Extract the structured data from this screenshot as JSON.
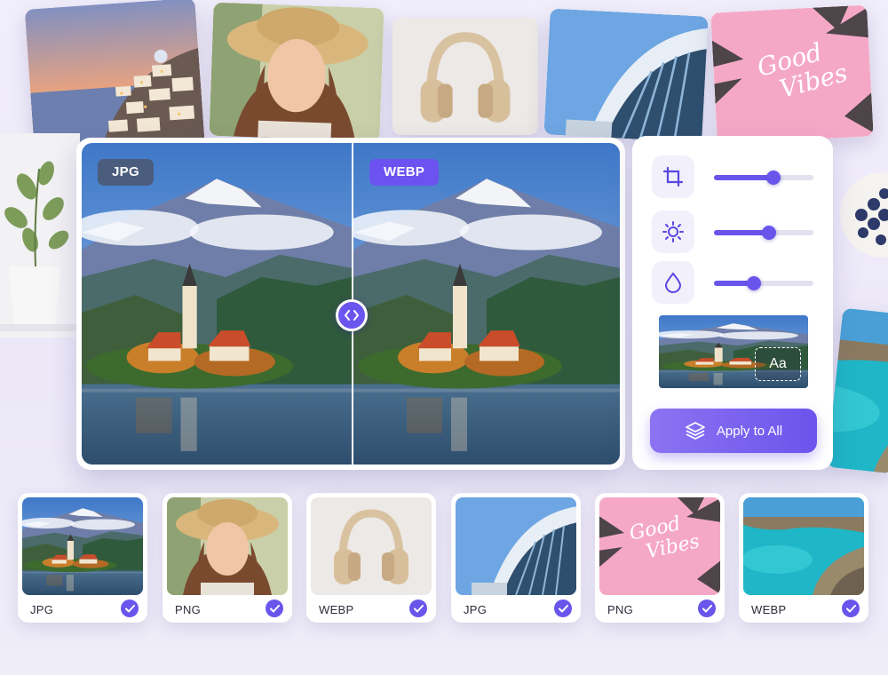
{
  "comparison": {
    "left_format": "JPG",
    "right_format": "WEBP",
    "handle_icon": "code-brackets-icon"
  },
  "settings": {
    "tools": [
      {
        "icon": "crop-icon",
        "level": 0.6
      },
      {
        "icon": "brightness-icon",
        "level": 0.55
      },
      {
        "icon": "droplet-icon",
        "level": 0.4
      }
    ],
    "text_overlay_label": "Aa",
    "apply_button_label": "Apply to All",
    "apply_button_icon": "layers-icon"
  },
  "thumbnails": [
    {
      "format": "JPG",
      "subject": "lake-church",
      "checked": true
    },
    {
      "format": "PNG",
      "subject": "portrait",
      "checked": true
    },
    {
      "format": "WEBP",
      "subject": "headphones",
      "checked": true
    },
    {
      "format": "JPG",
      "subject": "building",
      "checked": true
    },
    {
      "format": "PNG",
      "subject": "good-vibes",
      "checked": true
    },
    {
      "format": "WEBP",
      "subject": "coast",
      "checked": true
    }
  ],
  "good_vibes_text": [
    "Good",
    "Vibes"
  ],
  "colors": {
    "accent": "#6a55ec",
    "jpg_badge": "#4a5d7d",
    "webp_badge": "#6c52f0"
  }
}
